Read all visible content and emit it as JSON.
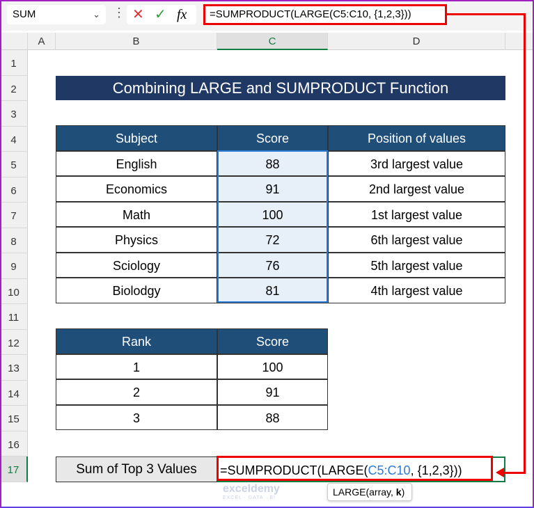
{
  "formula_bar": {
    "name_box": "SUM",
    "formula": "=SUMPRODUCT(LARGE(C5:C10, {1,2,3}))",
    "cancel_icon": "✕",
    "enter_icon": "✓",
    "fx_label": "fx"
  },
  "columns": [
    "A",
    "B",
    "C",
    "D"
  ],
  "rows": [
    "1",
    "2",
    "3",
    "4",
    "5",
    "6",
    "7",
    "8",
    "9",
    "10",
    "11",
    "12",
    "13",
    "14",
    "15",
    "16",
    "17"
  ],
  "title": "Combining LARGE and SUMPRODUCT Function",
  "table1": {
    "headers": [
      "Subject",
      "Score",
      "Position of values"
    ],
    "rows": [
      [
        "English",
        "88",
        "3rd largest value"
      ],
      [
        "Economics",
        "91",
        "2nd largest value"
      ],
      [
        "Math",
        "100",
        "1st largest value"
      ],
      [
        "Physics",
        "72",
        "6th largest value"
      ],
      [
        "Sciology",
        "76",
        "5th largest value"
      ],
      [
        "Biolodgy",
        "81",
        "4th largest value"
      ]
    ]
  },
  "table2": {
    "headers": [
      "Rank",
      "Score"
    ],
    "rows": [
      [
        "1",
        "100"
      ],
      [
        "2",
        "91"
      ],
      [
        "3",
        "88"
      ]
    ]
  },
  "result": {
    "label": "Sum of Top 3 Values",
    "formula_parts": [
      "=SUMPRODUCT(LARGE(",
      "C5:C10",
      ", {1,2,3}))"
    ]
  },
  "tooltip": {
    "text": "LARGE(array, ",
    "bold_arg": "k",
    ")": ")",
    "close": ")"
  },
  "watermark": {
    "brand": "exceldemy",
    "tagline": "EXCEL · DATA · BI"
  },
  "colors": {
    "header": "#1f4e79",
    "title": "#203864",
    "highlight": "#e00000",
    "range_ref": "#2b7bd6"
  }
}
